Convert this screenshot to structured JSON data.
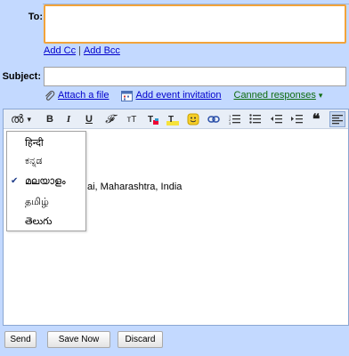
{
  "compose": {
    "to_label": "To:",
    "to_value": "",
    "add_cc": "Add Cc",
    "cc_separator": "|",
    "add_bcc": "Add Bcc",
    "subject_label": "Subject:",
    "subject_value": ""
  },
  "attachments": {
    "attach_file": "Attach a file",
    "add_event": "Add event invitation",
    "canned": "Canned responses",
    "canned_arrow": "▾"
  },
  "toolbar": {
    "lang_glyph": "ൽ",
    "lang_arrow": "▾",
    "bold": "B",
    "italic": "I",
    "underline": "U",
    "font": "𝓕",
    "size": "тT",
    "text_color": "T",
    "highlight": "T",
    "quote": "❝"
  },
  "language_menu": {
    "items": [
      {
        "label": "हिन्दी",
        "checked": false
      },
      {
        "label": "ಕನ್ನಡ",
        "checked": false
      },
      {
        "label": "മലയാളം",
        "checked": true
      },
      {
        "label": "தமிழ்",
        "checked": false
      },
      {
        "label": "తెలుగు",
        "checked": false
      }
    ],
    "check_glyph": "✔"
  },
  "body": {
    "text": "ai, Maharashtra, India"
  },
  "actions": {
    "send": "Send",
    "save": "Save Now",
    "discard": "Discard"
  },
  "colors": {
    "page_bg": "#c3d9ff",
    "focus_border": "#f2a33a",
    "link": "#0000cc",
    "canned": "#0d6b0d"
  }
}
